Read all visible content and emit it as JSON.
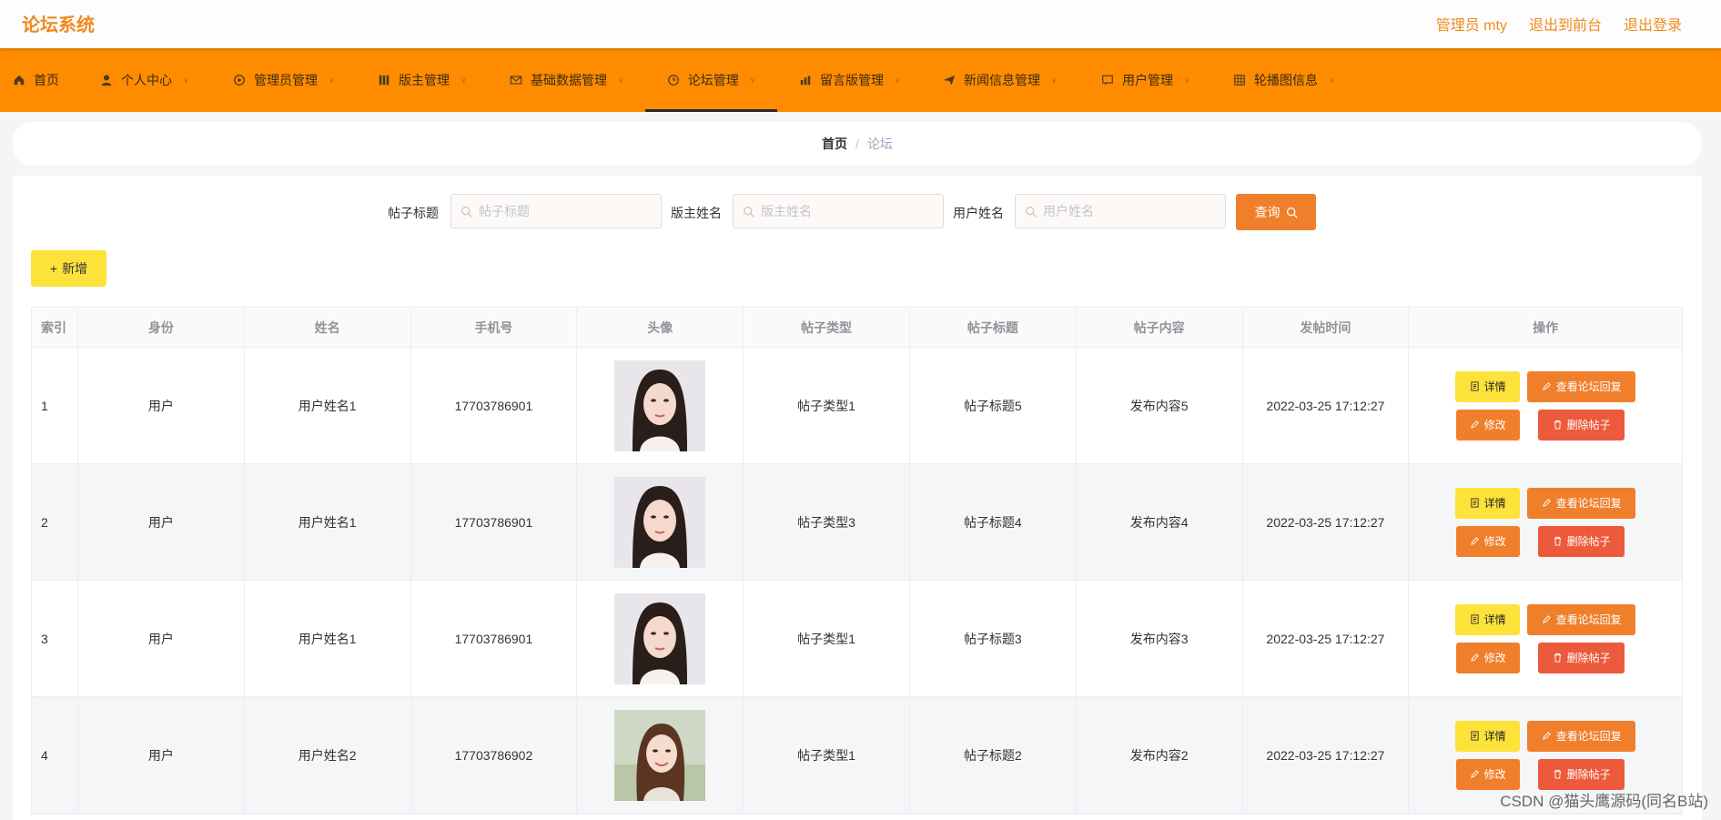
{
  "app": {
    "title": "论坛系统",
    "user_label": "管理员 mty",
    "front_label": "退出到前台",
    "logout_label": "退出登录"
  },
  "nav": {
    "items": [
      {
        "label": "首页",
        "icon": "home-icon"
      },
      {
        "label": "个人中心",
        "icon": "user-icon"
      },
      {
        "label": "管理员管理",
        "icon": "settings-icon"
      },
      {
        "label": "版主管理",
        "icon": "grid-icon"
      },
      {
        "label": "基础数据管理",
        "icon": "mail-icon"
      },
      {
        "label": "论坛管理",
        "icon": "clock-icon"
      },
      {
        "label": "留言版管理",
        "icon": "chart-icon"
      },
      {
        "label": "新闻信息管理",
        "icon": "send-icon"
      },
      {
        "label": "用户管理",
        "icon": "chat-icon"
      },
      {
        "label": "轮播图信息",
        "icon": "table-icon"
      }
    ],
    "active": "论坛管理",
    "accent": "#ff8c00"
  },
  "breadcrumb": {
    "home": "首页",
    "current": "论坛",
    "separator": "/"
  },
  "search": {
    "title_label": "帖子标题",
    "title_placeholder": "帖子标题",
    "moderator_label": "版主姓名",
    "moderator_placeholder": "版主姓名",
    "user_label": "用户姓名",
    "user_placeholder": "用户姓名",
    "query_label": "查询"
  },
  "toolbar": {
    "add_label": "新增"
  },
  "table": {
    "headers": [
      "索引",
      "身份",
      "姓名",
      "手机号",
      "头像",
      "帖子类型",
      "帖子标题",
      "帖子内容",
      "发帖时间",
      "操作"
    ],
    "rows": [
      {
        "index": "1",
        "role": "用户",
        "name": "用户姓名1",
        "phone": "17703786901",
        "avatar": "avatar-woman-1",
        "type": "帖子类型1",
        "title": "帖子标题5",
        "content": "发布内容5",
        "time": "2022-03-25 17:12:27"
      },
      {
        "index": "2",
        "role": "用户",
        "name": "用户姓名1",
        "phone": "17703786901",
        "avatar": "avatar-woman-1",
        "type": "帖子类型3",
        "title": "帖子标题4",
        "content": "发布内容4",
        "time": "2022-03-25 17:12:27"
      },
      {
        "index": "3",
        "role": "用户",
        "name": "用户姓名1",
        "phone": "17703786901",
        "avatar": "avatar-woman-1",
        "type": "帖子类型1",
        "title": "帖子标题3",
        "content": "发布内容3",
        "time": "2022-03-25 17:12:27"
      },
      {
        "index": "4",
        "role": "用户",
        "name": "用户姓名2",
        "phone": "17703786902",
        "avatar": "avatar-woman-2",
        "type": "帖子类型1",
        "title": "帖子标题2",
        "content": "发布内容2",
        "time": "2022-03-25 17:12:27"
      }
    ],
    "actions": {
      "detail": "详情",
      "reply": "查看论坛回复",
      "edit": "修改",
      "delete": "删除帖子"
    }
  },
  "watermark": "CSDN @猫头鹰源码(同名B站)"
}
